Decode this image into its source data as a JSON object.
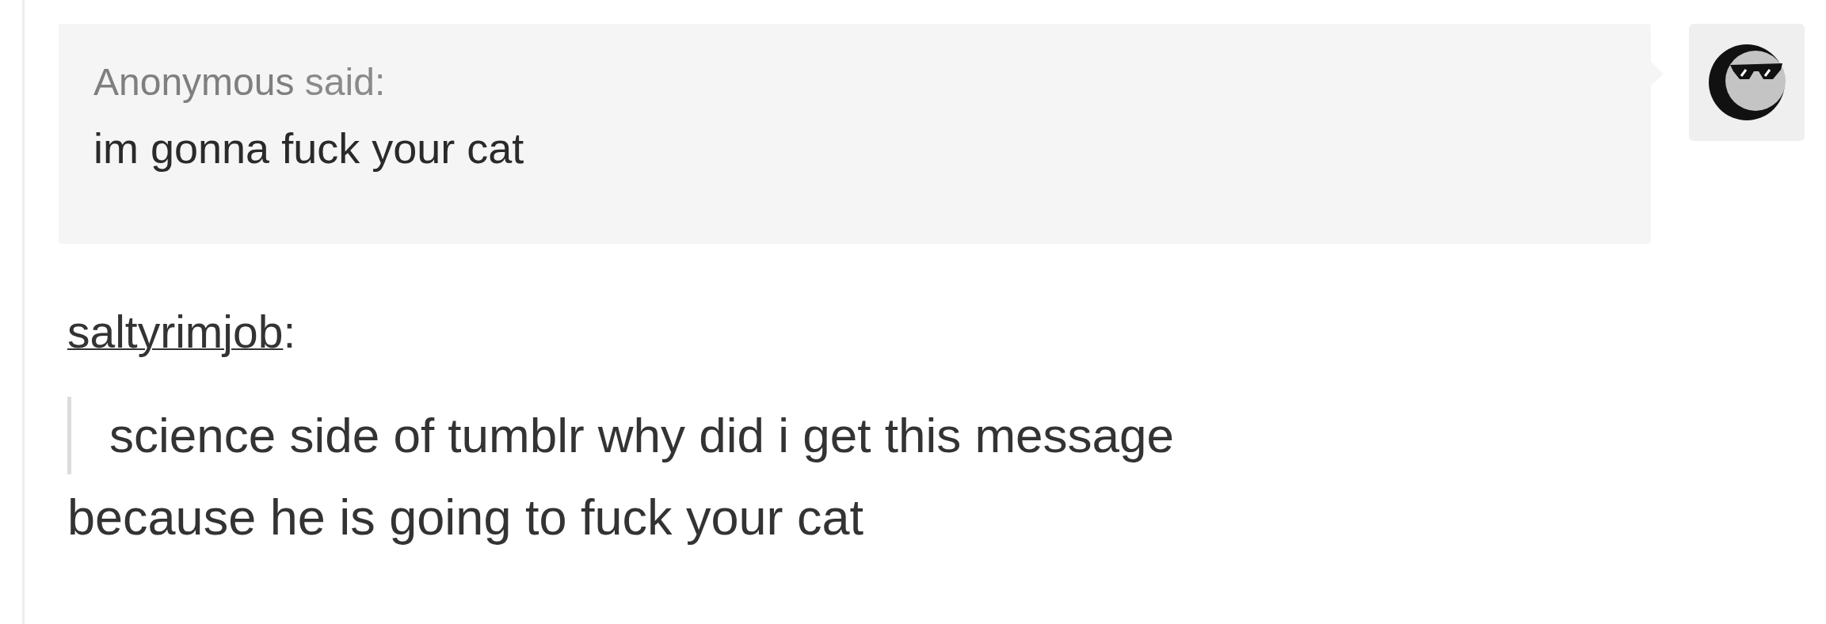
{
  "ask": {
    "asker": "Anonymous",
    "said_label": "said:",
    "question": "im gonna fuck your cat"
  },
  "answer": {
    "username": "saltyrimjob",
    "username_suffix": ":",
    "quote": "science side of tumblr why did i get this message",
    "reply": "because he is going to fuck your cat"
  }
}
